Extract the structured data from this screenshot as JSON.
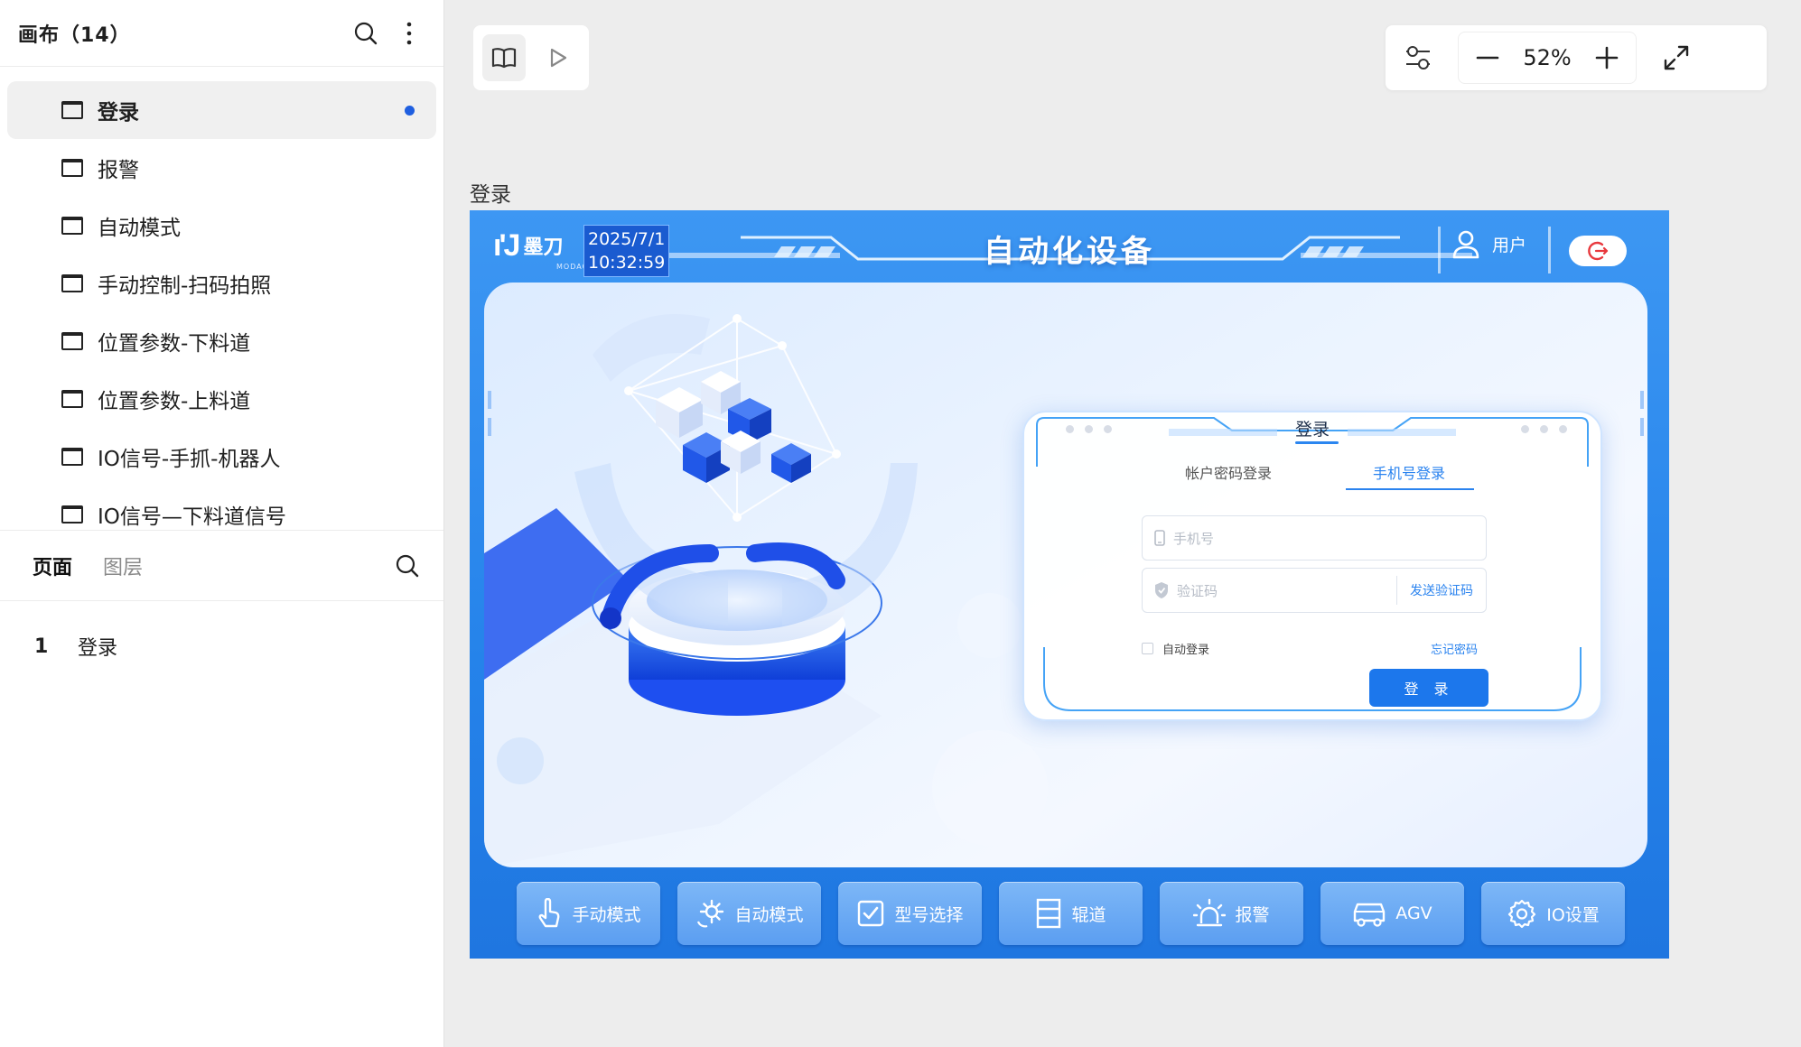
{
  "sidebar": {
    "title": "画布（14）",
    "canvases": [
      {
        "label": "登录",
        "active": true
      },
      {
        "label": "报警",
        "active": false
      },
      {
        "label": "自动模式",
        "active": false
      },
      {
        "label": "手动控制-扫码拍照",
        "active": false
      },
      {
        "label": "位置参数-下料道",
        "active": false
      },
      {
        "label": "位置参数-上料道",
        "active": false
      },
      {
        "label": "IO信号-手抓-机器人",
        "active": false
      },
      {
        "label": "IO信号—下料道信号",
        "active": false
      }
    ],
    "tabs": {
      "pages": "页面",
      "layers": "图层"
    },
    "pages": [
      {
        "num": "1",
        "label": "登录"
      }
    ]
  },
  "toolbar": {
    "zoom": "52%"
  },
  "frame": {
    "label": "登录",
    "header": {
      "logo_name": "墨刀",
      "logo_sub": "MODAO.CC",
      "date": "2025/7/1",
      "time": "10:32:59",
      "title": "自动化设备",
      "user": "用户"
    },
    "login": {
      "title": "登录",
      "tab_password": "帐户密码登录",
      "tab_phone": "手机号登录",
      "phone_placeholder": "手机号",
      "code_placeholder": "验证码",
      "send_code": "发送验证码",
      "auto_login": "自动登录",
      "forgot": "忘记密码",
      "submit": "登 录"
    },
    "nav": [
      {
        "label": "手动模式",
        "icon": "hand-pointer-icon"
      },
      {
        "label": "自动模式",
        "icon": "gear-auto-icon"
      },
      {
        "label": "型号选择",
        "icon": "checkbox-icon"
      },
      {
        "label": "辊道",
        "icon": "roller-icon"
      },
      {
        "label": "报警",
        "icon": "alarm-light-icon"
      },
      {
        "label": "AGV",
        "icon": "agv-vehicle-icon"
      },
      {
        "label": "IO设置",
        "icon": "settings-gear-icon"
      }
    ]
  },
  "colors": {
    "accent": "#1f5fe0",
    "frame_blue": "#2583ea",
    "login_button": "#1c77ec"
  }
}
